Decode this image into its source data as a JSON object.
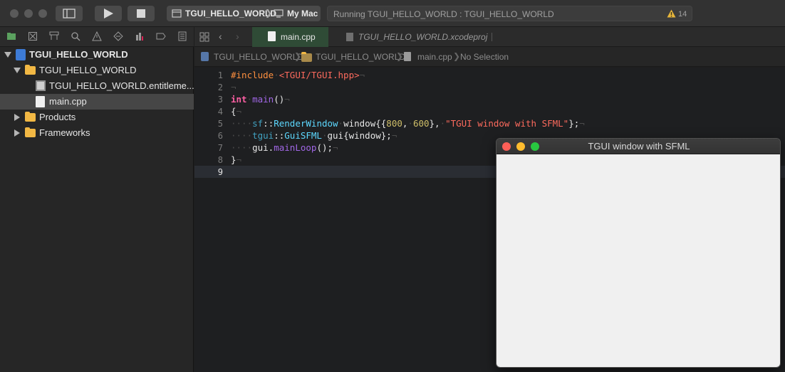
{
  "toolbar": {
    "scheme_target": "TGUI_HELLO_WORLD",
    "scheme_device": "My Mac",
    "status_text": "Running TGUI_HELLO_WORLD : TGUI_HELLO_WORLD",
    "warning_count": "14"
  },
  "navigator": {
    "items": [
      {
        "label": "TGUI_HELLO_WORLD"
      },
      {
        "label": "TGUI_HELLO_WORLD"
      },
      {
        "label": "TGUI_HELLO_WORLD.entitleme..."
      },
      {
        "label": "main.cpp"
      },
      {
        "label": "Products"
      },
      {
        "label": "Frameworks"
      }
    ]
  },
  "tabs": [
    {
      "label": "main.cpp"
    },
    {
      "label": "TGUI_HELLO_WORLD.xcodeproj"
    }
  ],
  "jumpbar": {
    "project": "TGUI_HELLO_WORLD",
    "group": "TGUI_HELLO_WORLD",
    "file": "main.cpp",
    "selection": "No Selection"
  },
  "editor": {
    "line_numbers": [
      "1",
      "2",
      "3",
      "4",
      "5",
      "6",
      "7",
      "8",
      "9"
    ],
    "code": {
      "l1_directive": "#include",
      "l1_path": "<TGUI/TGUI.hpp>",
      "l3_type": "int",
      "l3_name": "main",
      "l3_rest": "()",
      "l4": "{",
      "l5_ns": "sf",
      "l5_cls": "RenderWindow",
      "l5_var": "window{{",
      "l5_n1": "800",
      "l5_n2": "600",
      "l5_str": "\"TGUI window with SFML\"",
      "l5_end": "};",
      "l6_ns": "tgui",
      "l6_cls": "GuiSFML",
      "l6_var": "gui{window};",
      "l7_obj": "gui.",
      "l7_fn": "mainLoop",
      "l7_end": "();",
      "l8": "}"
    }
  },
  "sfml_window": {
    "title": "TGUI window with SFML"
  },
  "colors": {
    "accent_tab": "#2f4b36",
    "folder": "#f2b844",
    "keyword": "#fc5fa3",
    "string": "#fc6a5d",
    "number": "#d0bf69",
    "class": "#5dd8ff",
    "function": "#a167e6"
  }
}
